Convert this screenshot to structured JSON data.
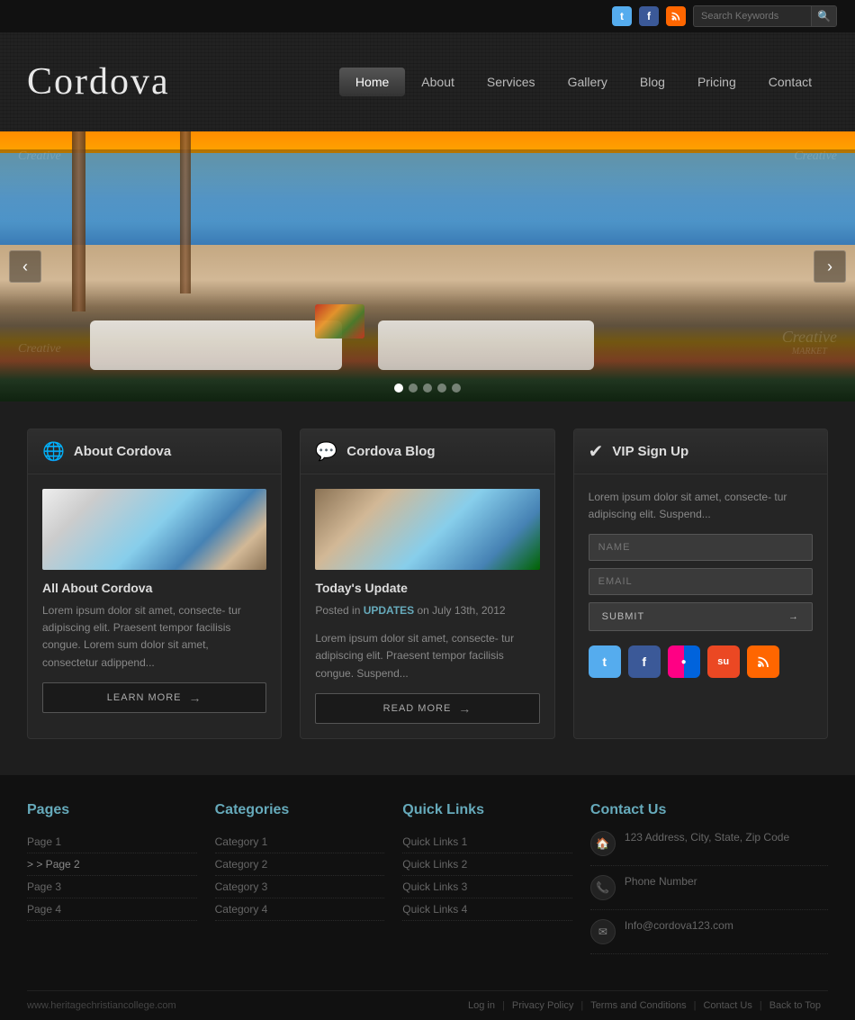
{
  "topbar": {
    "search_placeholder": "Search Keywords"
  },
  "header": {
    "logo": "Cordova",
    "nav": [
      {
        "label": "Home",
        "active": true
      },
      {
        "label": "About"
      },
      {
        "label": "Services"
      },
      {
        "label": "Gallery"
      },
      {
        "label": "Blog"
      },
      {
        "label": "Pricing"
      },
      {
        "label": "Contact"
      }
    ]
  },
  "hero": {
    "arrows": {
      "left": "‹",
      "right": "›"
    },
    "dots": 5
  },
  "about_card": {
    "title": "About Cordova",
    "post_title": "All About Cordova",
    "body": "Lorem ipsum dolor sit amet, consecte- tur adipiscing elit. Praesent tempor facilisis congue. Lorem sum dolor sit amet, consectetur adippend...",
    "btn_label": "LEARN MORE"
  },
  "blog_card": {
    "title": "Cordova Blog",
    "post_title": "Today's Update",
    "meta_prefix": "Posted in ",
    "meta_tag": "UPDATES",
    "meta_date": "on July 13th, 2012",
    "body": "Lorem ipsum dolor sit amet, consecte- tur adipiscing elit. Praesent tempor facilisis congue. Suspend...",
    "btn_label": "READ MORE"
  },
  "vip_card": {
    "title": "VIP Sign Up",
    "desc": "Lorem ipsum dolor sit amet, consecte- tur adipiscing elit. Suspend...",
    "name_placeholder": "NAME",
    "email_placeholder": "EMAIL",
    "submit_label": "SUBMIT"
  },
  "footer": {
    "pages": {
      "title": "Pages",
      "items": [
        "Page 1",
        "> Page 2",
        "Page 3",
        "Page 4"
      ]
    },
    "categories": {
      "title": "Categories",
      "items": [
        "Category 1",
        "Category 2",
        "Category 3",
        "Category 4"
      ]
    },
    "quick_links": {
      "title": "Quick Links",
      "items": [
        "Quick Links 1",
        "Quick Links 2",
        "Quick Links 3",
        "Quick Links 4"
      ]
    },
    "contact": {
      "title": "Contact Us",
      "address": "123 Address, City, State, Zip Code",
      "phone": "Phone Number",
      "email": "Info@cordova123.com"
    },
    "bottom": {
      "url": "www.heritagechristiancollege.com",
      "links": [
        "Log in",
        "Privacy Policy",
        "Terms and Conditions",
        "Contact Us",
        "Back to Top"
      ]
    }
  }
}
